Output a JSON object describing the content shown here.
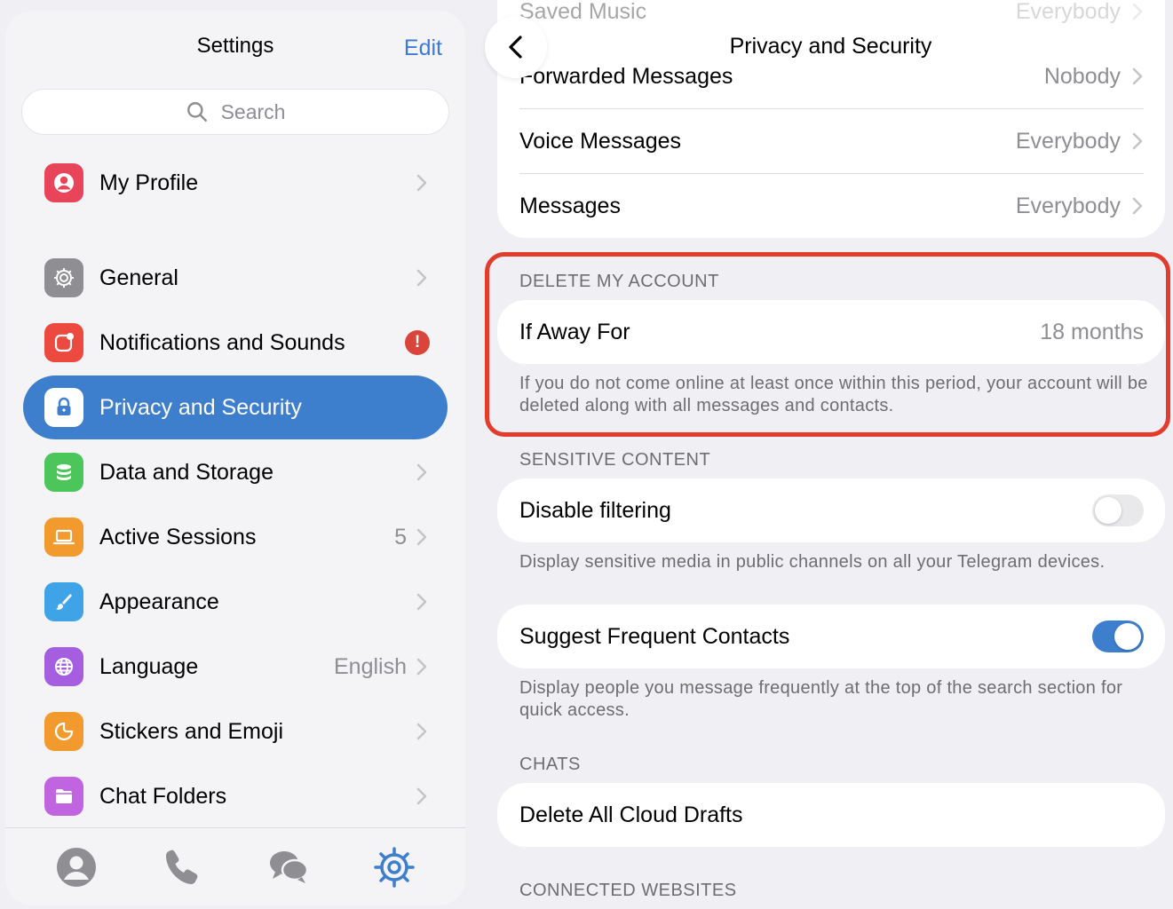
{
  "sidebar": {
    "title": "Settings",
    "edit_label": "Edit",
    "search_placeholder": "Search",
    "items": [
      {
        "label": "My Profile",
        "icon": "profile-icon",
        "color": "#e8455a"
      },
      {
        "label": "General",
        "icon": "gear-icon",
        "color": "#8e8e93"
      },
      {
        "label": "Notifications and Sounds",
        "icon": "notification-icon",
        "color": "#ec4a3e",
        "badge": "!"
      },
      {
        "label": "Privacy and Security",
        "icon": "lock-icon",
        "color": "#ffffff",
        "active": true
      },
      {
        "label": "Data and Storage",
        "icon": "database-icon",
        "color": "#4cc55a"
      },
      {
        "label": "Active Sessions",
        "icon": "laptop-icon",
        "color": "#f29a2e",
        "value": "5"
      },
      {
        "label": "Appearance",
        "icon": "brush-icon",
        "color": "#3fa3e8"
      },
      {
        "label": "Language",
        "icon": "globe-icon",
        "color": "#a55ee0",
        "value": "English"
      },
      {
        "label": "Stickers and Emoji",
        "icon": "sticker-icon",
        "color": "#f29a2e"
      },
      {
        "label": "Chat Folders",
        "icon": "folder-icon",
        "color": "#c064e0"
      }
    ],
    "tabs": [
      {
        "name": "contacts-tab",
        "icon": "person-icon"
      },
      {
        "name": "calls-tab",
        "icon": "phone-icon"
      },
      {
        "name": "chats-tab",
        "icon": "chat-bubbles-icon"
      },
      {
        "name": "settings-tab",
        "icon": "settings-gear-icon",
        "active": true
      }
    ]
  },
  "panel": {
    "title": "Privacy and Security",
    "privacy_rows": [
      {
        "label": "Saved Music",
        "value": "Everybody"
      },
      {
        "label": "Forwarded Messages",
        "value": "Nobody"
      },
      {
        "label": "Voice Messages",
        "value": "Everybody"
      },
      {
        "label": "Messages",
        "value": "Everybody"
      }
    ],
    "delete_account": {
      "header": "DELETE MY ACCOUNT",
      "row_label": "If Away For",
      "row_value": "18 months",
      "footnote": "If you do not come online at least once within this period, your account will be deleted along with all messages and contacts."
    },
    "sensitive": {
      "header": "SENSITIVE CONTENT",
      "row_label": "Disable filtering",
      "toggle_on": false,
      "footnote": "Display sensitive media in public channels on all your Telegram devices."
    },
    "suggest": {
      "row_label": "Suggest Frequent Contacts",
      "toggle_on": true,
      "footnote": "Display people you message frequently at the top of the search section for quick access."
    },
    "chats": {
      "header": "CHATS",
      "row_label": "Delete All Cloud Drafts"
    },
    "connected": {
      "header": "CONNECTED WEBSITES"
    }
  },
  "colors": {
    "accent": "#3e7fcd",
    "highlight": "#e33b2c"
  }
}
